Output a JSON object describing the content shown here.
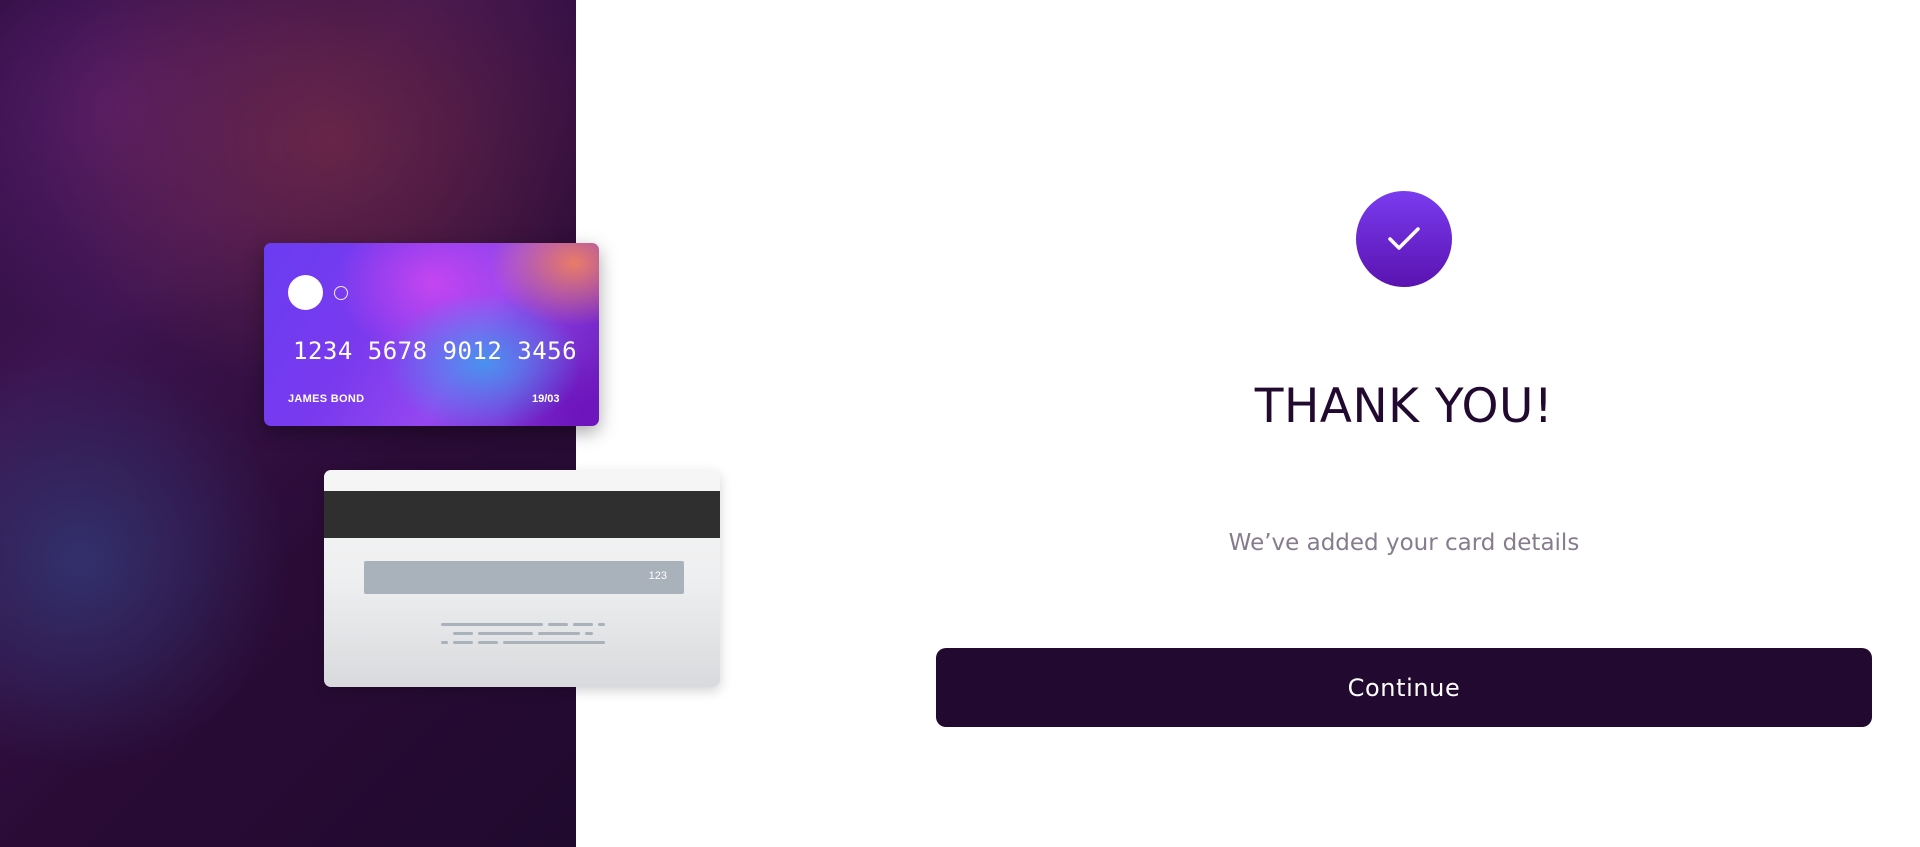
{
  "card_front": {
    "number": "1234 5678 9012 3456",
    "holder": "JAMES BOND",
    "expiry": "19/03"
  },
  "card_back": {
    "cvv": "123"
  },
  "confirmation": {
    "icon": "checkmark-icon",
    "title": "THANK YOU!",
    "subtitle": "We’ve added your card details",
    "continue_label": "Continue"
  },
  "colors": {
    "brand_dark": "#22092f",
    "accent_purple": "#6a24d8",
    "subtitle_gray": "#867c8d"
  }
}
